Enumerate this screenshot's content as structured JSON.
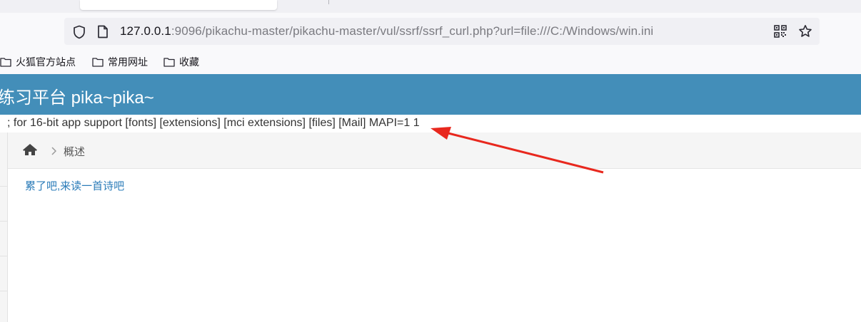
{
  "browser": {
    "url_host": "127.0.0.1",
    "url_rest": ":9096/pikachu-master/pikachu-master/vul/ssrf/ssrf_curl.php?url=file:///C:/Windows/win.ini",
    "bookmarks": [
      {
        "label": "火狐官方站点",
        "icon": "folder-icon"
      },
      {
        "label": "常用网址",
        "icon": "folder-icon"
      },
      {
        "label": "收藏",
        "icon": "folder-icon"
      }
    ]
  },
  "page": {
    "brand": "练习平台 pika~pika~",
    "file_output": "; for 16-bit app support [fonts] [extensions] [mci extensions] [files] [Mail] MAPI=1 1",
    "breadcrumb": {
      "current": "概述"
    },
    "poem_link": "累了吧,来读一首诗吧"
  },
  "colors": {
    "header_bg": "#438eb9",
    "link": "#2a7bb8",
    "annotation_arrow": "#e8281e"
  }
}
